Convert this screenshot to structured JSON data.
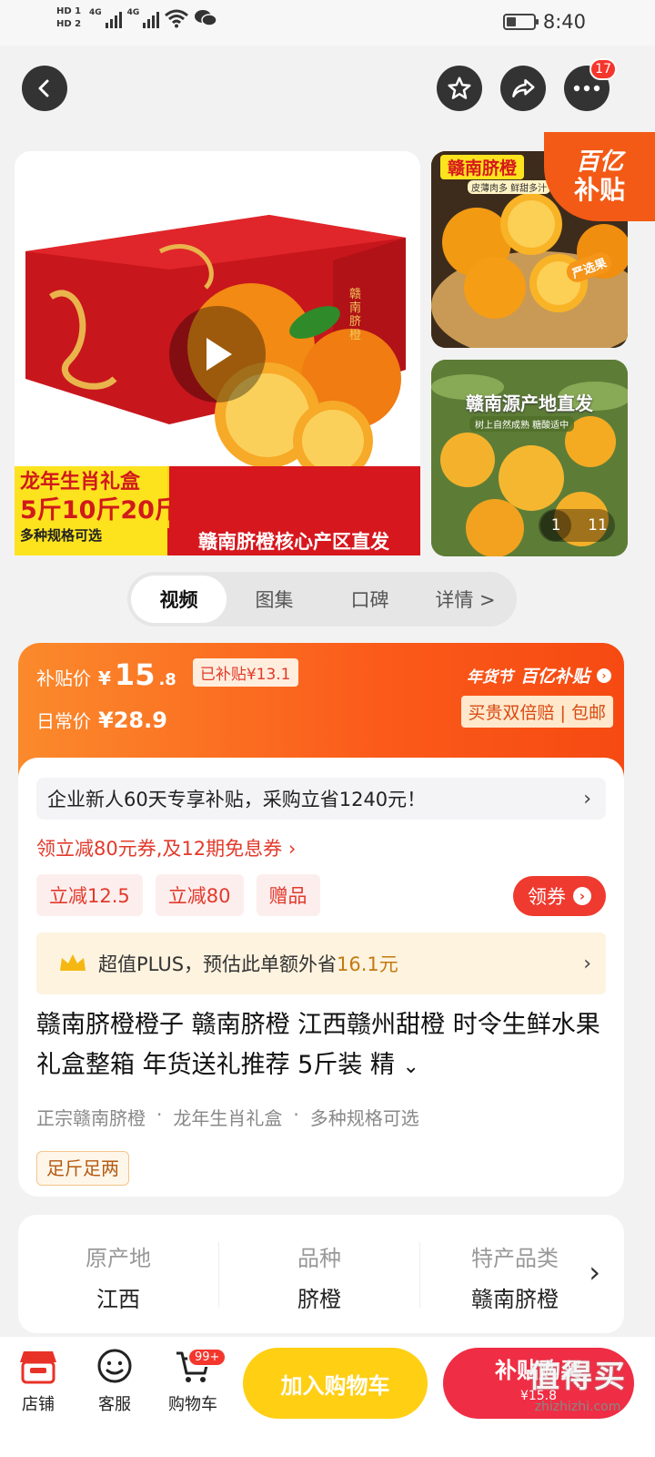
{
  "status_bar": {
    "hd1": "HD 1",
    "hd2": "HD 2",
    "net1": "4G",
    "net2": "4G",
    "battery_level": 0.35,
    "time": "8:40"
  },
  "top_nav": {
    "more_badge": "17"
  },
  "gallery": {
    "main_banner_line1": "龙年生肖礼盒",
    "main_banner_sizes": "5斤10斤20斤",
    "main_banner_sub": "多种规格可选",
    "main_banner_tagline": "赣南脐橙核心产区直发",
    "box_text": "赣南脐橙",
    "thumb1_title": "赣南脐橙",
    "thumb1_sub": "皮薄肉多 鲜甜多汁",
    "thumb1_sticker": "严选果",
    "thumb2_title": "赣南源产地直发",
    "thumb2_sub": "树上自然成熟 糖酸适中",
    "thumb2_counter_current": "1",
    "thumb2_counter_total": "11",
    "subsidy_corner_line1": "百亿",
    "subsidy_corner_line2": "补贴"
  },
  "tabs": [
    {
      "label": "视频"
    },
    {
      "label": "图集"
    },
    {
      "label": "口碑"
    },
    {
      "label": "详情 >"
    }
  ],
  "price": {
    "subsidy_label": "补贴价",
    "currency": "¥",
    "subsidy_int": "15",
    "subsidy_dec": ".8",
    "already_subsidy": "已补贴¥13.1",
    "regular_label": "日常价",
    "regular_price": "¥28.9",
    "festival_tag": "年货节",
    "program_tag": "百亿补贴",
    "guarantee": "买贵双倍赔 | 包邮"
  },
  "promo": {
    "enterprise_text": "企业新人60天专享补贴，采购立省1240元！",
    "coupon_text": "领立减80元券,及12期免息券",
    "chips": [
      "立减12.5",
      "立减80",
      "赠品"
    ],
    "claim_button": "领券",
    "plus_text_prefix": "超值PLUS，预估此单额外省",
    "plus_amount": "16.1元"
  },
  "product": {
    "title": "赣南脐橙橙子 赣南脐橙 江西赣州甜橙 时令生鲜水果礼盒整箱 年货送礼推荐 5斤装 精",
    "features": [
      "正宗赣南脐橙",
      "龙年生肖礼盒",
      "多种规格可选"
    ],
    "tag": "足斤足两"
  },
  "specs": [
    {
      "label": "原产地",
      "value": "江西"
    },
    {
      "label": "品种",
      "value": "脐橙"
    },
    {
      "label": "特产品类",
      "value": "赣南脐橙"
    }
  ],
  "bottom_bar": {
    "shop": "店铺",
    "service": "客服",
    "cart": "购物车",
    "cart_badge": "99+",
    "add_to_cart": "加入购物车",
    "buy_label": "补贴购买",
    "buy_price": "¥15.8",
    "watermark_cn": "值得买",
    "watermark_domain": "zhizhizhi.com"
  },
  "colors": {
    "accent_orange": "#fb5a1a",
    "accent_red": "#ef2d44",
    "cart_yellow": "#ffcf14",
    "coupon_red": "#e23a2c"
  }
}
